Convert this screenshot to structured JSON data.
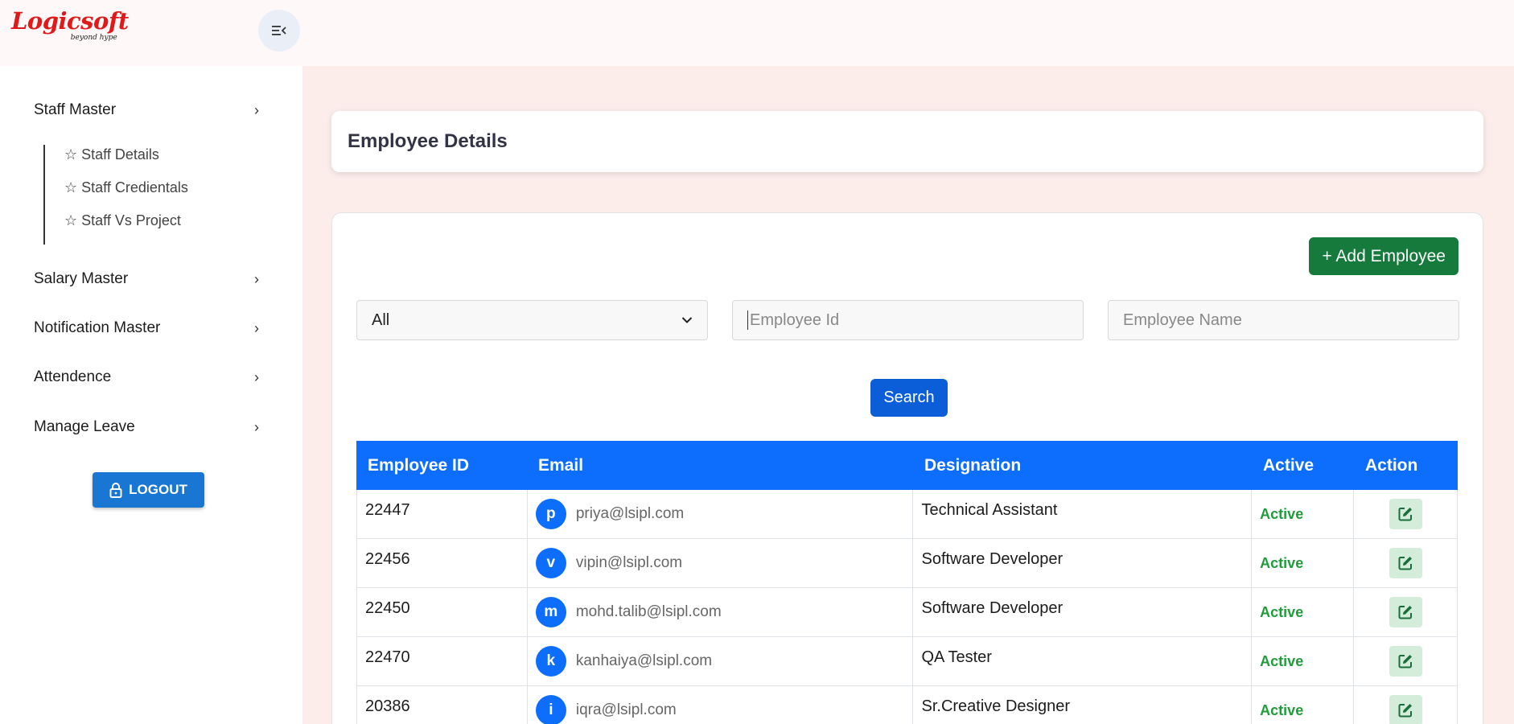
{
  "brand": {
    "name": "Logicsoft",
    "tagline": "beyond hype"
  },
  "sidebar": {
    "items": [
      {
        "label": "Staff Master",
        "expanded": true,
        "children": [
          "☆ Staff Details",
          "☆ Staff Credientals",
          "☆ Staff Vs Project"
        ]
      },
      {
        "label": "Salary Master"
      },
      {
        "label": "Notification Master"
      },
      {
        "label": "Attendence"
      },
      {
        "label": "Manage Leave"
      }
    ],
    "chevron": "›",
    "logout_label": "LOGOUT"
  },
  "page": {
    "title": "Employee Details"
  },
  "toolbar": {
    "add_label": "+ Add Employee",
    "filter_selected": "All",
    "employee_id_placeholder": "Employee Id",
    "employee_name_placeholder": "Employee Name",
    "search_label": "Search"
  },
  "table": {
    "columns": [
      "Employee ID",
      "Email",
      "Designation",
      "Active",
      "Action"
    ],
    "rows": [
      {
        "id": "22447",
        "initial": "p",
        "email": "priya@lsipl.com",
        "designation": "Technical Assistant",
        "status": "Active"
      },
      {
        "id": "22456",
        "initial": "v",
        "email": "vipin@lsipl.com",
        "designation": "Software Developer",
        "status": "Active"
      },
      {
        "id": "22450",
        "initial": "m",
        "email": "mohd.talib@lsipl.com",
        "designation": "Software Developer",
        "status": "Active"
      },
      {
        "id": "22470",
        "initial": "k",
        "email": "kanhaiya@lsipl.com",
        "designation": "QA Tester",
        "status": "Active"
      },
      {
        "id": "20386",
        "initial": "i",
        "email": "iqra@lsipl.com",
        "designation": "Sr.Creative Designer",
        "status": "Active"
      }
    ]
  },
  "colors": {
    "primary": "#0d6efd",
    "success": "#157a3c",
    "brand": "#e01a1a",
    "active": "#1f9d3a"
  }
}
